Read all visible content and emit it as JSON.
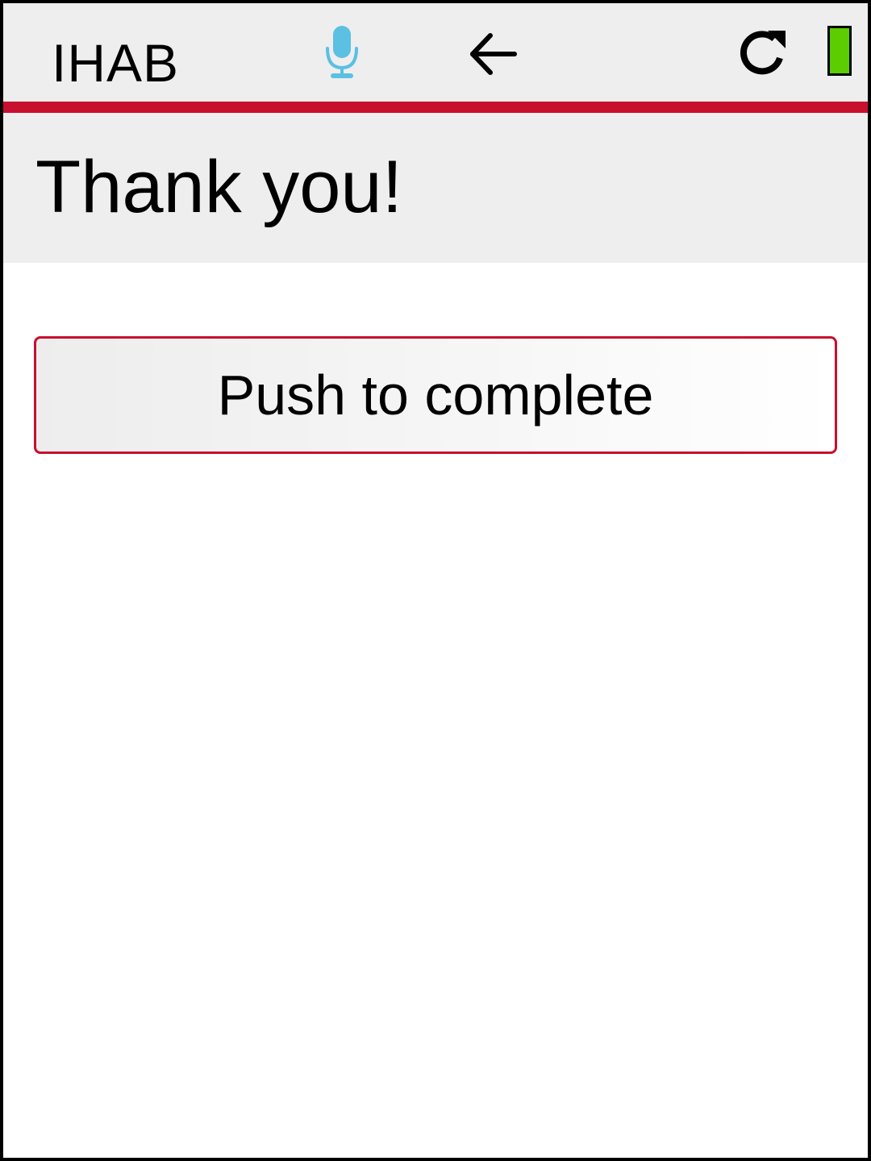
{
  "colors": {
    "accent": "#c8102e",
    "bar_background": "#eeeeee",
    "mic_icon": "#5bc0e2",
    "battery_level": "#5ccd00"
  },
  "topbar": {
    "app_title": "IHAB",
    "icons": [
      "microphone-icon",
      "back-arrow-icon",
      "refresh-icon",
      "battery-icon"
    ],
    "battery_level_fraction": 1.0
  },
  "header": {
    "title": "Thank you!"
  },
  "main": {
    "complete_button_label": "Push to complete"
  }
}
